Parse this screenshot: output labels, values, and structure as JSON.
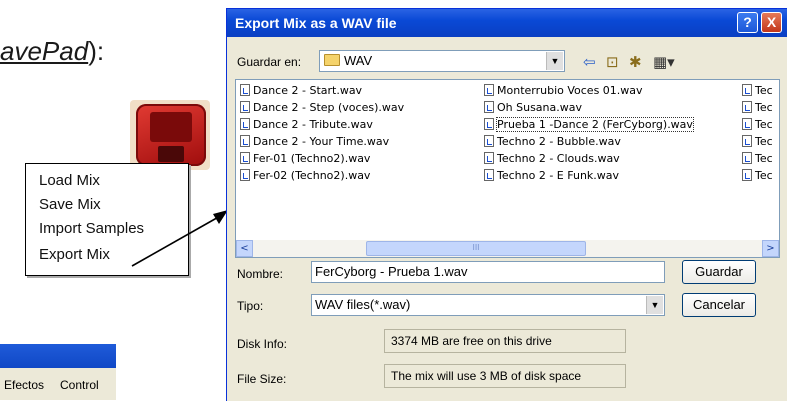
{
  "document": {
    "title_text": "avePad",
    "title_suffix": "):",
    "context_menu": [
      "Load Mix",
      "Save Mix",
      "Import Samples",
      "Export Mix"
    ],
    "mini_menu": [
      "Efectos",
      "Control"
    ]
  },
  "dialog": {
    "title": "Export Mix as a WAV file",
    "help_label": "?",
    "close_label": "X",
    "save_in_label": "Guardar en:",
    "save_in_value": "WAV",
    "files_col1": [
      "Dance 2 - Start.wav",
      "Dance 2 - Step (voces).wav",
      "Dance 2 - Tribute.wav",
      "Dance 2 - Your Time.wav",
      "Fer-01 (Techno2).wav",
      "Fer-02 (Techno2).wav"
    ],
    "files_col2": [
      "Monterrubio Voces 01.wav",
      "Oh Susana.wav",
      "Prueba 1 -Dance 2 (FerCyborg).wav",
      "Techno 2 - Bubble.wav",
      "Techno 2 - Clouds.wav",
      "Techno 2 - E Funk.wav"
    ],
    "files_col3": [
      "Tec",
      "Tec",
      "Tec",
      "Tec",
      "Tec",
      "Tec"
    ],
    "selected_file": "Prueba 1 -Dance 2 (FerCyborg).wav",
    "name_label": "Nombre:",
    "name_value": "FerCyborg - Prueba 1.wav",
    "type_label": "Tipo:",
    "type_value": "WAV files(*.wav)",
    "save_button": "Guardar",
    "cancel_button": "Cancelar",
    "disk_info_label": "Disk Info:",
    "disk_info_value": "3374 MB are free on this drive",
    "file_size_label": "File Size:",
    "file_size_value": "The mix will use 3 MB of disk space",
    "scroll_thumb_grip": "III",
    "scroll_left": "<",
    "scroll_right": ">",
    "dropdown_arrow": "▼"
  },
  "colors": {
    "titlebar": "#0a49d6",
    "dialog_bg": "#ece9d8"
  }
}
